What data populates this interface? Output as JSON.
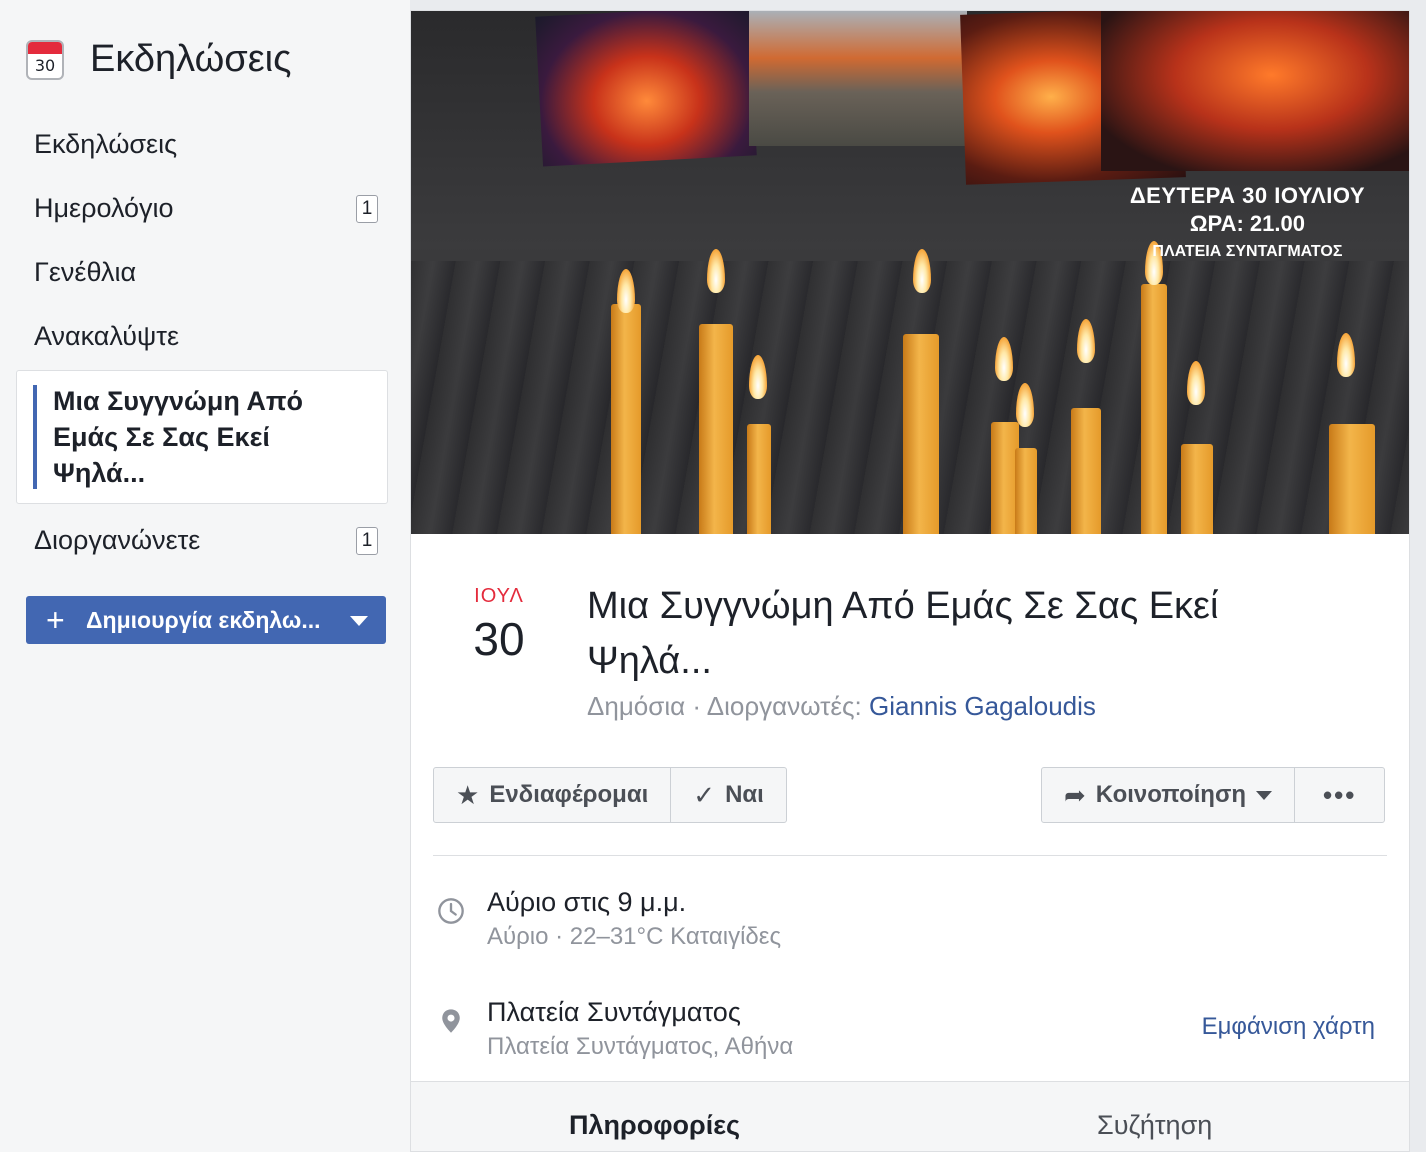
{
  "sidebar": {
    "title": "Εκδηλώσεις",
    "calendar_icon_day": "30",
    "items": [
      {
        "label": "Εκδηλώσεις",
        "badge": null
      },
      {
        "label": "Ημερολόγιο",
        "badge": "1"
      },
      {
        "label": "Γενέθλια",
        "badge": null
      },
      {
        "label": "Ανακαλύψτε",
        "badge": null
      }
    ],
    "active_item": "Μια Συγγνώμη Από Εμάς Σε Σας Εκεί Ψηλά...",
    "organizing": {
      "label": "Διοργανώνετε",
      "badge": "1"
    },
    "create_button": "Δημιουργία εκδηλω..."
  },
  "cover": {
    "line1": "ΔΕΥΤΕΡΑ 30 ΙΟΥΛΙΟΥ",
    "line2": "ΩΡΑ: 21.00",
    "line3": "ΠΛΑΤΕΙΑ ΣΥΝΤΑΓΜΑΤΟΣ"
  },
  "event": {
    "month": "ΙΟΥΛ",
    "day": "30",
    "title": "Μια Συγγνώμη Από Εμάς Σε Σας Εκεί Ψηλά...",
    "meta_prefix": "Δημόσια · Διοργανωτές: ",
    "host": "Giannis Gagaloudis"
  },
  "actions": {
    "interested": "Ενδιαφέρομαι",
    "going": "Ναι",
    "share": "Κοινοποίηση",
    "more": "•••"
  },
  "details": {
    "time_main": "Αύριο στις 9 μ.μ.",
    "time_sub": "Αύριο · 22–31°C Καταιγίδες",
    "place_main": "Πλατεία Συντάγματος",
    "place_sub": "Πλατεία Συντάγματος, Αθήνα",
    "map_link": "Εμφάνιση χάρτη"
  },
  "tabs": {
    "info": "Πληροφορίες",
    "discussion": "Συζήτηση"
  },
  "colors": {
    "accent": "#4267b2",
    "link": "#365899",
    "date_red": "#e42b3c"
  }
}
